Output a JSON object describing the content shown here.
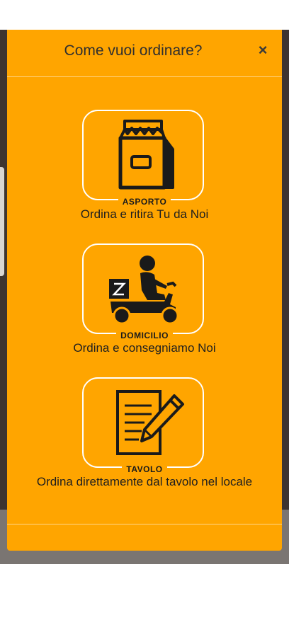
{
  "modal": {
    "title": "Come vuoi ordinare?",
    "close_icon": "×"
  },
  "options": [
    {
      "tag": "ASPORTO",
      "description": "Ordina e ritira Tu da Noi",
      "icon": "takeaway-bag-icon"
    },
    {
      "tag": "DOMICILIO",
      "description": "Ordina e consegniamo Noi",
      "icon": "delivery-scooter-icon"
    },
    {
      "tag": "TAVOLO",
      "description": "Ordina direttamente dal tavolo nel locale",
      "icon": "table-order-icon"
    }
  ],
  "colors": {
    "modal_background": "#ffa500",
    "backdrop": "#3d3430",
    "option_border": "#ffffff"
  }
}
